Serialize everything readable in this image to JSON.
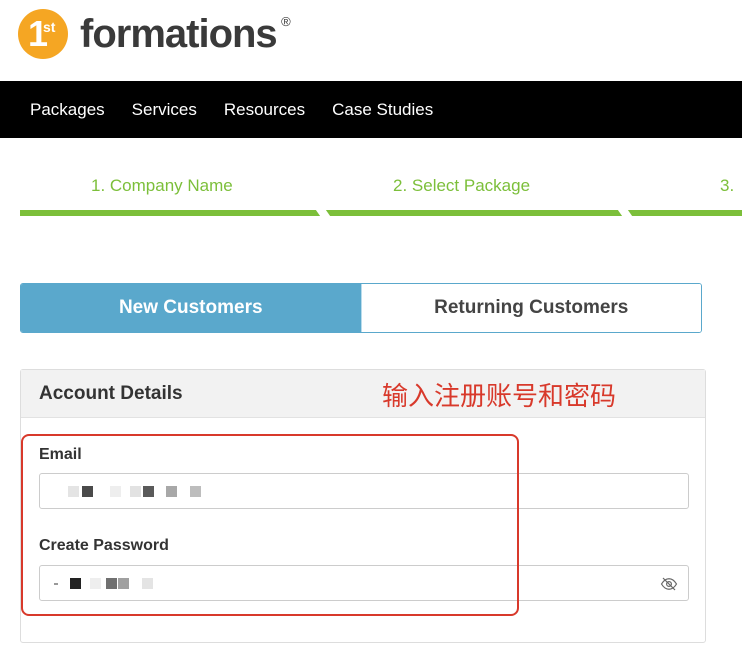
{
  "logo": {
    "number": "1",
    "suffix": "st",
    "word": "formations",
    "registered": "®"
  },
  "nav": {
    "items": [
      "Packages",
      "Services",
      "Resources",
      "Case Studies"
    ]
  },
  "steps": [
    "1. Company Name",
    "2. Select Package",
    "3."
  ],
  "tabs": {
    "new": "New Customers",
    "returning": "Returning Customers"
  },
  "panel": {
    "title": "Account Details",
    "annotation": "输入注册账号和密码",
    "email_label": "Email",
    "password_label": "Create Password"
  },
  "icons": {
    "password_toggle": "eye-slash-icon"
  },
  "colors": {
    "accent_blue": "#5aa8cc",
    "step_green": "#7cbf3a",
    "annotation_red": "#d8392b",
    "logo_orange": "#f5a623"
  }
}
